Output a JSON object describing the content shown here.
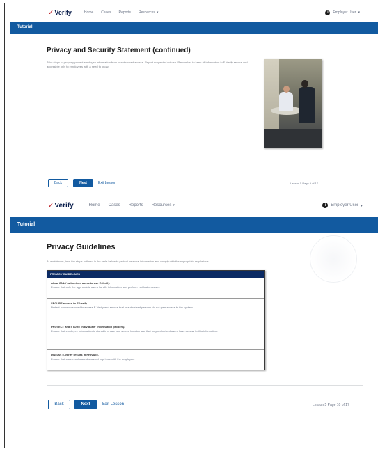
{
  "screen1": {
    "nav": {
      "logo_mark": "✓",
      "logo_text": "Verify",
      "links": [
        "Home",
        "Cases",
        "Reports",
        "Resources"
      ],
      "user": "Employer User"
    },
    "banner": "Tutorial",
    "title": "Privacy and Security Statement (continued)",
    "body": "Take steps to properly protect employee information from unauthorized access. Report suspected misuse. Remember to keep all information in E-Verify secure and accessible only to employees with a need to know.",
    "buttons": {
      "back": "Back",
      "next": "Next",
      "exit": "Exit Lesson"
    },
    "lesson_info": "Lesson 5   Page 9 of 17"
  },
  "screen2": {
    "nav": {
      "logo_mark": "✓",
      "logo_text": "Verify",
      "links": [
        "Home",
        "Cases",
        "Reports",
        "Resources"
      ],
      "user": "Employer User"
    },
    "banner": "Tutorial",
    "title": "Privacy Guidelines",
    "intro": "At a minimum, take the steps outlined in the table below to protect personal information and comply with the appropriate regulations.",
    "table_header": "PRIVACY GUIDELINES",
    "guidelines": [
      {
        "title": "Allow ONLY authorized users to use E-Verify.",
        "text": "Ensure that only the appropriate users handle information and perform verification cases."
      },
      {
        "title": "SECURE access to E-Verify.",
        "text": "Protect passwords used to access E-Verify and ensure that unauthorized persons do not gain access to the system."
      },
      {
        "title": "PROTECT and STORE individuals' information properly.",
        "text": "Ensure that employee information is stored in a safe and secure location and that only authorized users have access to this information."
      },
      {
        "title": "Discuss E-Verify results in PRIVATE.",
        "text": "Ensure that case results are discussed in private with the employee."
      }
    ],
    "buttons": {
      "back": "Back",
      "next": "Next",
      "exit": "Exit Lesson"
    },
    "lesson_info": "Lesson 5   Page 10 of 17"
  },
  "icons": {
    "user_info": "info-icon",
    "dropdown": "chevron-down-icon"
  },
  "colors": {
    "brand_blue": "#125aa0",
    "table_header": "#0b2a63",
    "logo_check": "#c0262d"
  }
}
